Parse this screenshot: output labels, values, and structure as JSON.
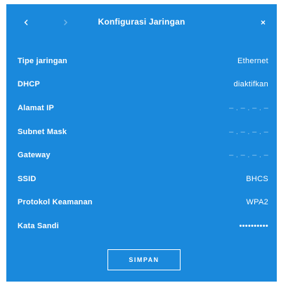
{
  "dialog": {
    "title": "Konfigurasi Jaringan",
    "icons": {
      "back": "chevron-left-icon",
      "forward": "chevron-right-icon",
      "close": "close-icon"
    },
    "colors": {
      "background": "#1a89dc",
      "text": "#ffffff"
    }
  },
  "fields": [
    {
      "label": "Tipe jaringan",
      "value": "Ethernet"
    },
    {
      "label": "DHCP",
      "value": "diaktifkan"
    },
    {
      "label": "Alamat IP",
      "value": "– . – . – . –"
    },
    {
      "label": "Subnet Mask",
      "value": "– . – . – . –"
    },
    {
      "label": "Gateway",
      "value": "– . – . – . –"
    },
    {
      "label": "SSID",
      "value": "BHCS"
    },
    {
      "label": "Protokol Keamanan",
      "value": "WPA2"
    },
    {
      "label": "Kata Sandi",
      "value": "••••••••••"
    }
  ],
  "actions": {
    "save_label": "SIMPAN"
  }
}
